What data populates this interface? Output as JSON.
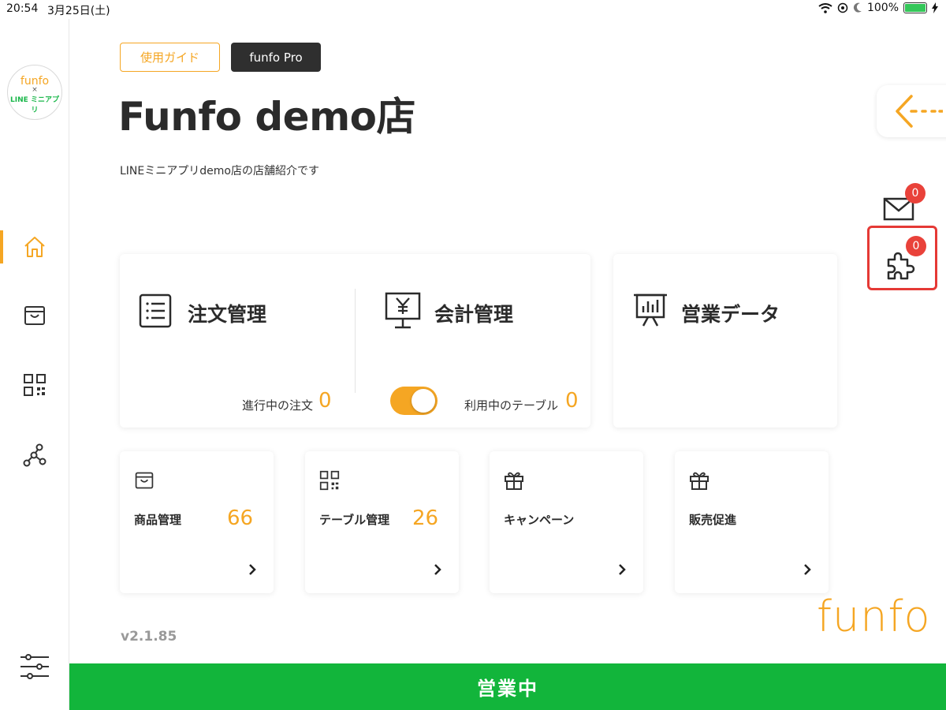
{
  "status_bar": {
    "time": "20:54",
    "date": "3月25日(土)",
    "battery": "100%"
  },
  "sidebar": {
    "logo": {
      "top": "funfo",
      "x": "×",
      "bottom": "LINE ミニアプリ"
    }
  },
  "header": {
    "guide_label": "使用ガイド",
    "pro_label": "funfo Pro",
    "store_name": "Funfo demo店",
    "store_description": "LINEミニアプリdemo店の店舗紹介です"
  },
  "toolbar": {
    "mail_count": "0",
    "plugin_count": "0"
  },
  "cards": {
    "orders": {
      "title": "注文管理",
      "label": "進行中の注文",
      "count": "0"
    },
    "accounting": {
      "title": "会計管理",
      "label": "利用中のテーブル",
      "count": "0"
    },
    "sales": {
      "title": "営業データ"
    }
  },
  "small_cards": [
    {
      "label": "商品管理",
      "count": "66"
    },
    {
      "label": "テーブル管理",
      "count": "26"
    },
    {
      "label": "キャンペーン"
    },
    {
      "label": "販売促進"
    }
  ],
  "footer": {
    "version": "v2.1.85",
    "brand": "funfo",
    "open_label": "営業中"
  },
  "colors": {
    "accent": "#f5a623",
    "open": "#12b53b",
    "badge": "#e9423a",
    "highlight": "#e53935"
  }
}
